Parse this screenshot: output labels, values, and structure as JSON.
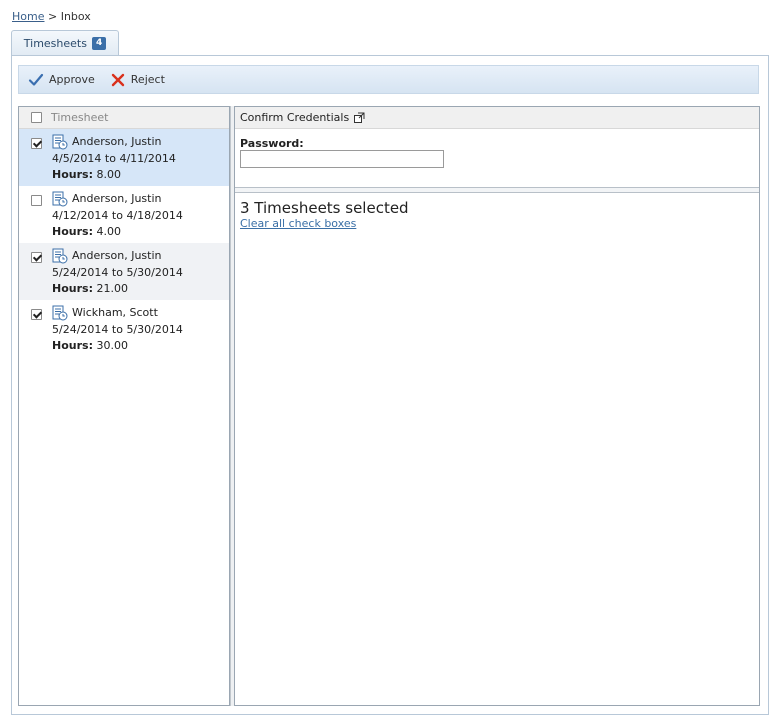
{
  "breadcrumb": {
    "home": "Home",
    "separator": ">",
    "current": "Inbox"
  },
  "tab": {
    "label": "Timesheets",
    "badge": "4"
  },
  "toolbar": {
    "approve_label": "Approve",
    "reject_label": "Reject"
  },
  "list": {
    "header": "Timesheet",
    "hours_label": "Hours:",
    "items": [
      {
        "name": "Anderson, Justin",
        "dates": "4/5/2014 to 4/11/2014",
        "hours": "8.00",
        "checked": true
      },
      {
        "name": "Anderson, Justin",
        "dates": "4/12/2014 to 4/18/2014",
        "hours": "4.00",
        "checked": false
      },
      {
        "name": "Anderson, Justin",
        "dates": "5/24/2014 to 5/30/2014",
        "hours": "21.00",
        "checked": true
      },
      {
        "name": "Wickham, Scott",
        "dates": "5/24/2014 to 5/30/2014",
        "hours": "30.00",
        "checked": true
      }
    ]
  },
  "details": {
    "title": "Confirm Credentials",
    "password_label": "Password:",
    "password_value": "",
    "selected_text": "3 Timesheets selected",
    "clear_link": "Clear all check boxes"
  },
  "colors": {
    "selected_row": "#d6e6f8",
    "accent": "#3b6fa8",
    "reject": "#d9301c",
    "approve": "#3a6fb0"
  },
  "icons": {
    "approve": "checkmark-icon",
    "reject": "x-icon",
    "timesheet": "timesheet-clock-icon",
    "external": "external-link-icon"
  }
}
